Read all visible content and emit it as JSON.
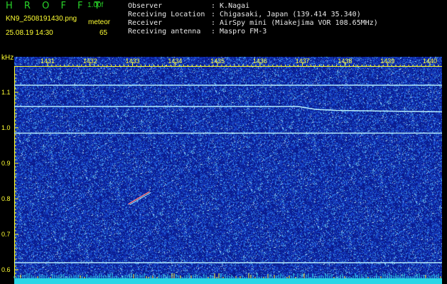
{
  "header": {
    "app_title": "H R O F F T",
    "version": "1.00f",
    "filename": "KN9_2508191430.png",
    "datetime": "25.08.19 14:30",
    "mode": "meteor",
    "count": "65"
  },
  "metadata": [
    {
      "label": "Observer",
      "value": ": K.Nagai"
    },
    {
      "label": "Receiving Location",
      "value": ": Chigasaki, Japan (139.414 35.340)"
    },
    {
      "label": "Receiver",
      "value": ": AirSpy mini (Miakejima VOR 108.65MHz)"
    },
    {
      "label": "Receiving antenna",
      "value": ": Maspro FM-3"
    }
  ],
  "chart_data": {
    "type": "heatmap",
    "ylabel": "kHz",
    "y_ticks": [
      "1.1",
      "1.0",
      "0.9",
      "0.8",
      "0.7",
      "0.6"
    ],
    "x_ticks": [
      "1431",
      "1432",
      "1433",
      "1434",
      "1435",
      "1436",
      "1437",
      "1438",
      "1439",
      "1440"
    ],
    "ylim": [
      0.58,
      1.15
    ],
    "xlim": [
      1430.5,
      1440.2
    ],
    "colors": {
      "background": "#0a1a8c",
      "signal": "#bff7ff",
      "axis": "#ffff33"
    },
    "carriers": [
      {
        "y_start": 1.12,
        "y_end": 1.12
      },
      {
        "y_start": 1.06,
        "y_end": 1.045
      },
      {
        "y_start": 0.985,
        "y_end": 0.985
      },
      {
        "y_start": 0.62,
        "y_end": 0.62
      }
    ],
    "meteor_echo": {
      "x_start": 1432.9,
      "x_end": 1433.4,
      "y_start": 0.785,
      "y_end": 0.82
    }
  }
}
